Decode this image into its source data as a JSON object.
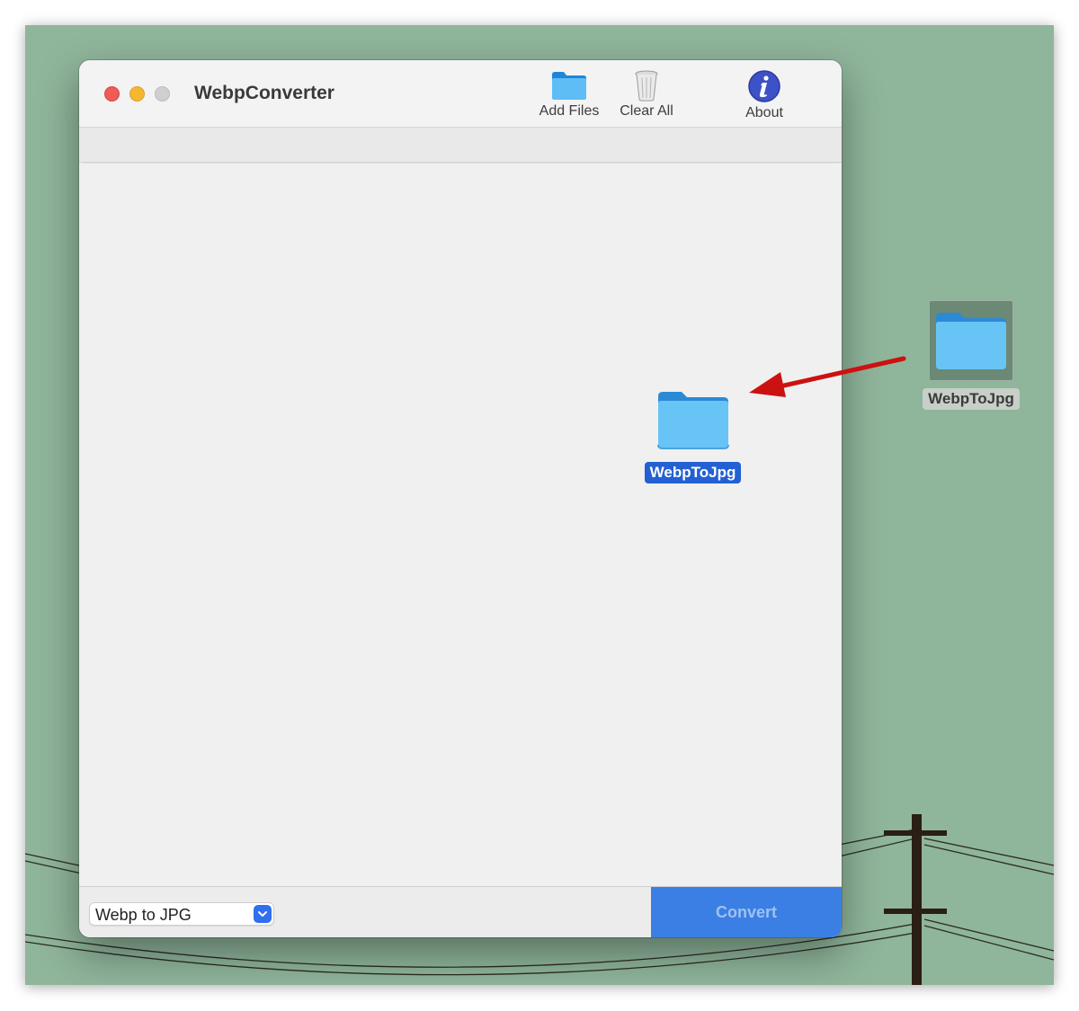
{
  "window": {
    "title": "WebpConverter"
  },
  "toolbar": {
    "add_files_label": "Add Files",
    "clear_all_label": "Clear All",
    "about_label": "About"
  },
  "bottom": {
    "format_value": "Webp to JPG",
    "convert_label": "Convert"
  },
  "drag": {
    "folder_name": "WebpToJpg"
  },
  "desktop": {
    "folder_name": "WebpToJpg"
  },
  "colors": {
    "desktop_bg": "#8fb59b",
    "convert_button": "#3b7fe4",
    "selection": "#2260d3",
    "arrow": "#d01010"
  },
  "icons": {
    "add_files": "folder-icon",
    "clear_all": "trash-icon",
    "about": "info-icon",
    "dragged": "folder-icon",
    "desktop_item": "folder-icon"
  }
}
